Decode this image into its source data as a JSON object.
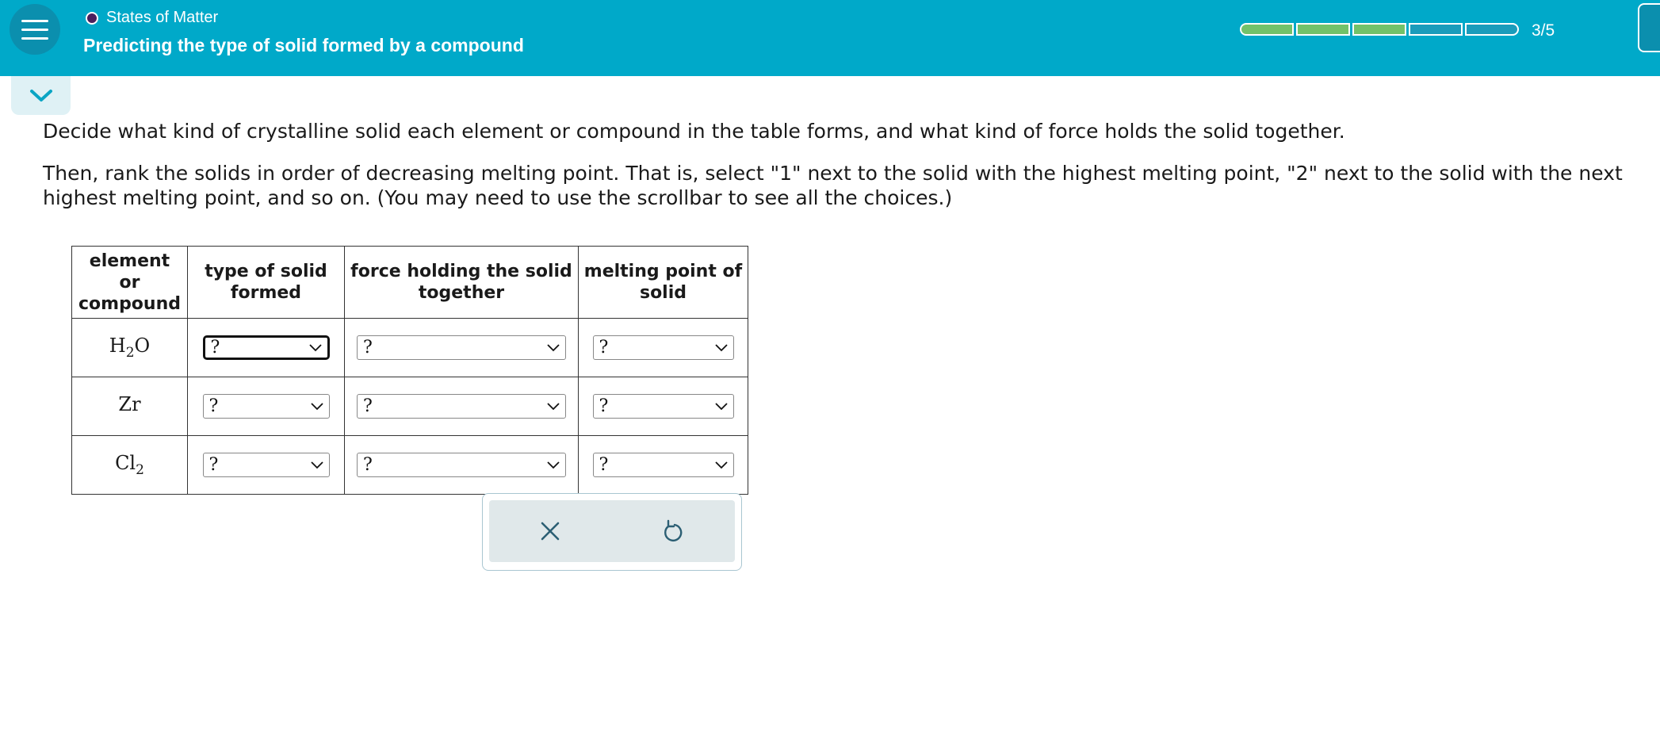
{
  "header": {
    "topic": "States of Matter",
    "title": "Predicting the type of solid formed by a compound",
    "progress_value": 0.6,
    "progress_label": "3/5",
    "progress_segments": [
      true,
      true,
      true,
      false,
      false
    ]
  },
  "icons": {
    "menu": "hamburger-menu-icon",
    "collapse": "chevron-down-icon",
    "clear": "x-icon",
    "undo": "undo-icon"
  },
  "colors": {
    "header_bg": "#00a9c9",
    "progress_filled": "#72c26a",
    "accent": "#0b8fae"
  },
  "instructions": {
    "p1": "Decide what kind of crystalline solid each element or compound in the table forms, and what kind of force holds the solid together.",
    "p2": "Then, rank the solids in order of decreasing melting point. That is, select \"1\" next to the solid with the highest melting point, \"2\" next to the solid with the next highest melting point, and so on. (You may need to use the scrollbar to see all the choices.)"
  },
  "table": {
    "headers": {
      "col1": "element or compound",
      "col2": "type of solid formed",
      "col3": "force holding the solid together",
      "col4": "melting point of solid"
    },
    "rows": [
      {
        "symbol": "H",
        "sub": "2",
        "tail": "O",
        "type": "?",
        "force": "?",
        "melting": "?"
      },
      {
        "symbol": "Zr",
        "sub": "",
        "tail": "",
        "type": "?",
        "force": "?",
        "melting": "?"
      },
      {
        "symbol": "Cl",
        "sub": "2",
        "tail": "",
        "type": "?",
        "force": "?",
        "melting": "?"
      }
    ]
  }
}
